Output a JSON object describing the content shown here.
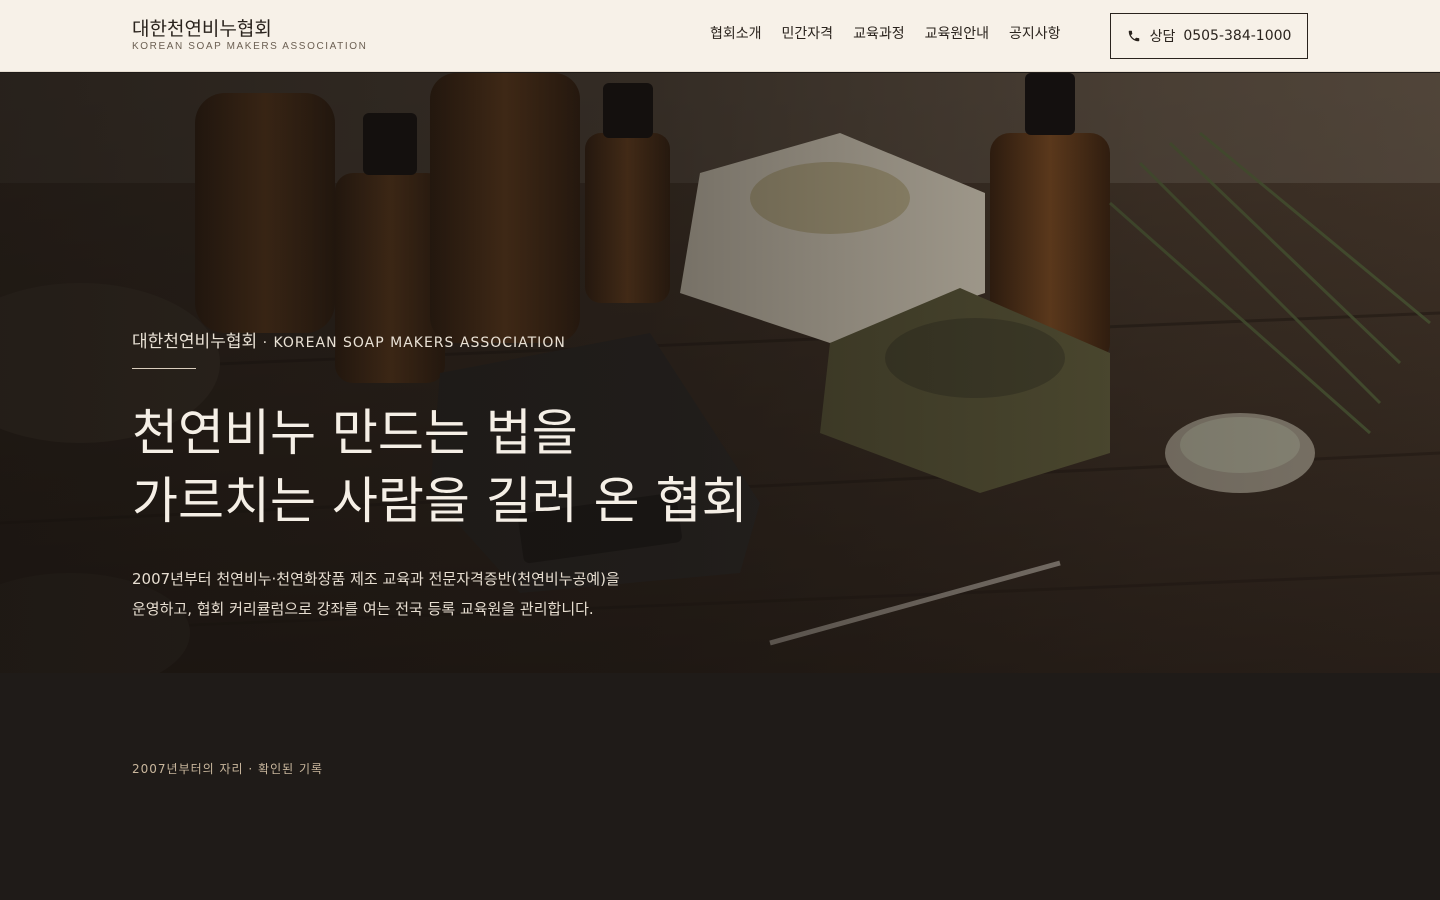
{
  "header": {
    "brand_ko": "대한천연비누협회",
    "brand_en": "KOREAN SOAP MAKERS ASSOCIATION",
    "nav": [
      "협회소개",
      "민간자격",
      "교육과정",
      "교육원안내",
      "공지사항"
    ],
    "cta_label": "상담",
    "cta_phone": "0505-384-1000",
    "cta_icon": "phone-icon"
  },
  "hero": {
    "eyebrow_ko": "대한천연비누협회",
    "eyebrow_sep": " · ",
    "eyebrow_en": "KOREAN SOAP MAKERS ASSOCIATION",
    "headline_line1": "천연비누 만드는 법을",
    "headline_line2": "가르치는 사람을 길러 온 협회",
    "lead_line1": "2007년부터 천연비누·천연화장품 제조 교육과 전문자격증반(천연비누공예)을",
    "lead_line2": "운영하고, 협회 커리큘럼으로 강좌를 여는 전국 등록 교육원을 관리합니다."
  },
  "section": {
    "kicker": "2007년부터의 자리 · 확인된 기록"
  },
  "colors": {
    "header_bg": "#f7f1e8",
    "dark_bg": "#1f1b18",
    "accent": "#c9b79d"
  }
}
